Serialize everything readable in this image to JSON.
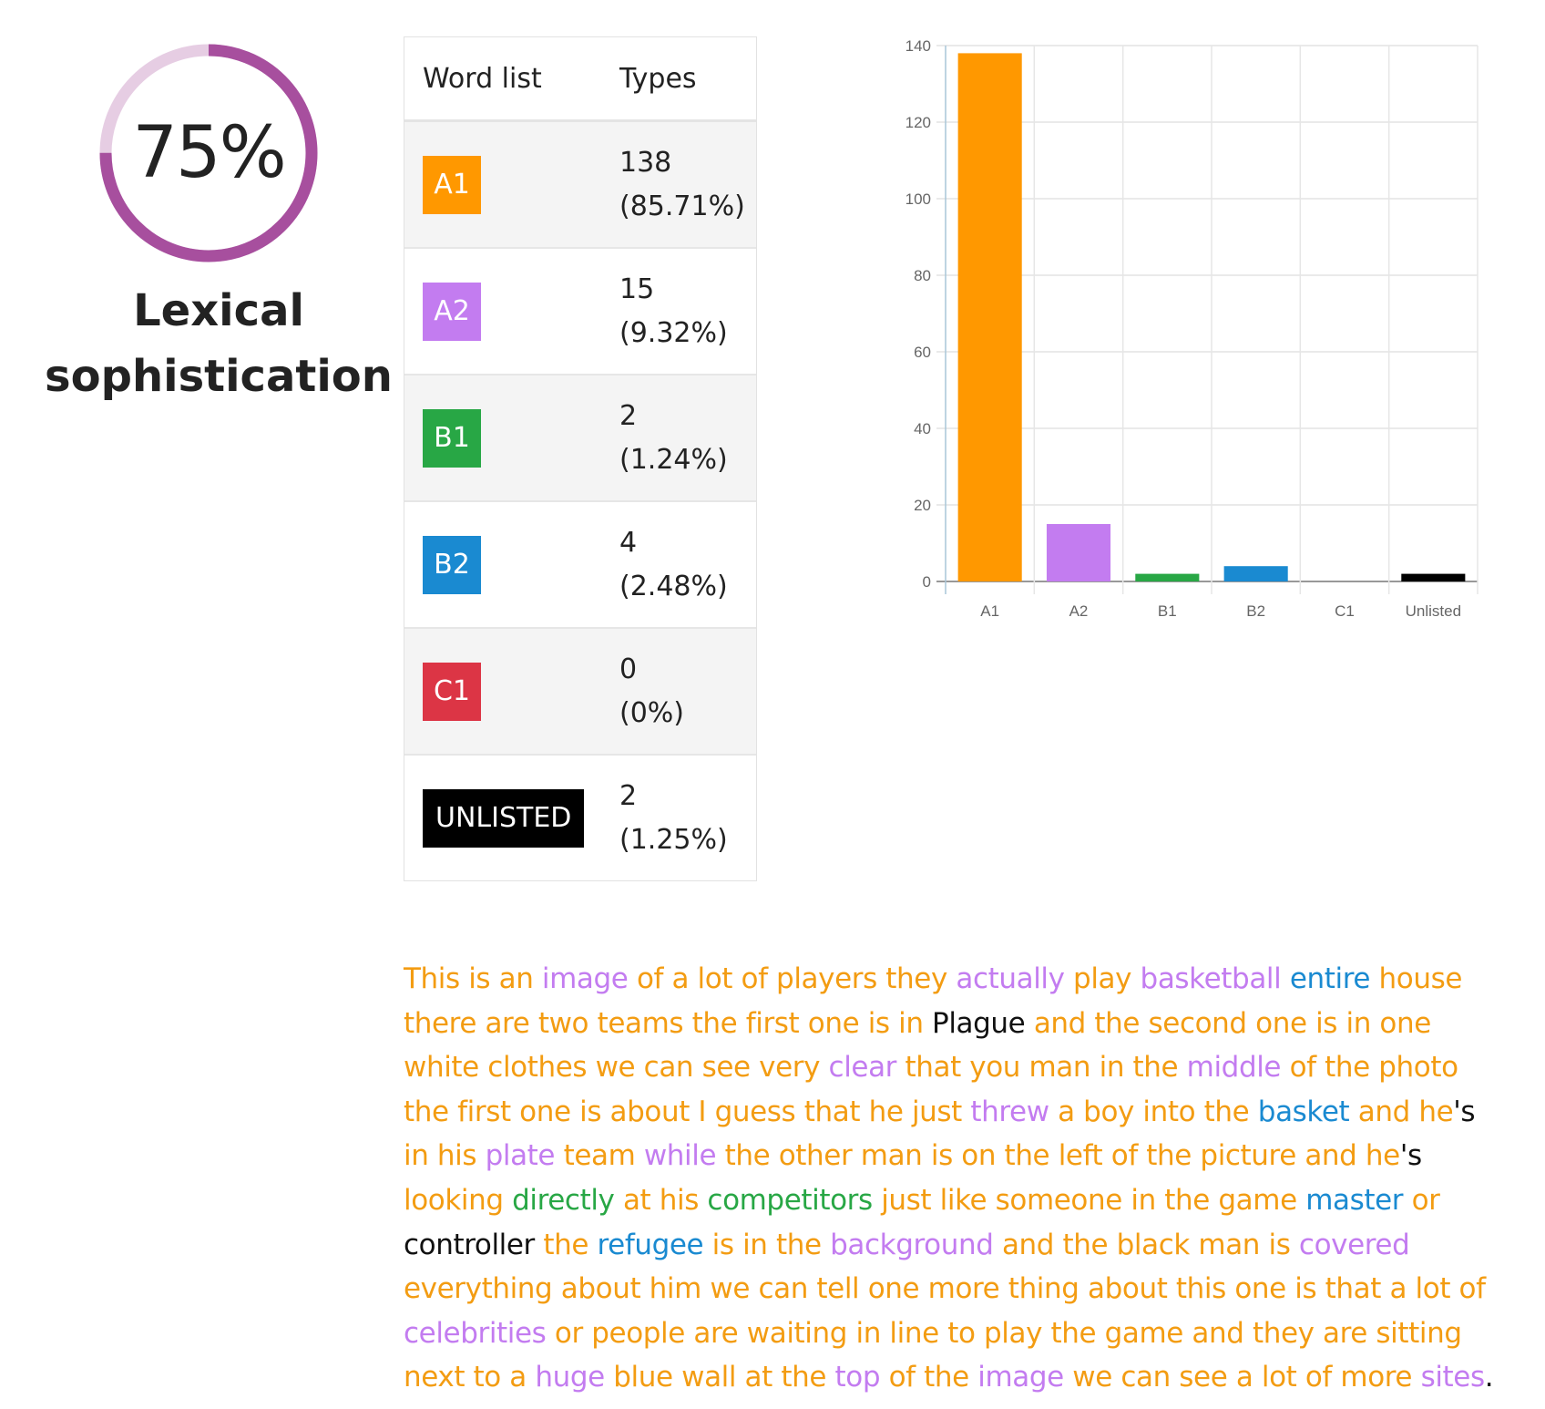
{
  "score": {
    "percent_label": "75%",
    "fraction": 0.75,
    "title_line1": "Lexical",
    "title_line2": "sophistication",
    "ring_color": "#a74f9e",
    "track_color": "#e6cde3"
  },
  "table": {
    "headers": [
      "Word list",
      "Types"
    ],
    "rows": [
      {
        "level": "A1",
        "count": "138",
        "pct": "(85.71%)",
        "color": "#ff9800"
      },
      {
        "level": "A2",
        "count": "15",
        "pct": "(9.32%)",
        "color": "#c37cf0"
      },
      {
        "level": "B1",
        "count": "2",
        "pct": "(1.24%)",
        "color": "#28a745"
      },
      {
        "level": "B2",
        "count": "4",
        "pct": "(2.48%)",
        "color": "#1a8ad1"
      },
      {
        "level": "C1",
        "count": "0",
        "pct": "(0%)",
        "color": "#dc3545"
      },
      {
        "level": "UNLISTED",
        "count": "2",
        "pct": "(1.25%)",
        "color": "#000000"
      }
    ]
  },
  "chart_data": {
    "type": "bar",
    "title": "",
    "xlabel": "",
    "ylabel": "",
    "categories": [
      "A1",
      "A2",
      "B1",
      "B2",
      "C1",
      "Unlisted"
    ],
    "values": [
      138,
      15,
      2,
      4,
      0,
      2
    ],
    "colors": [
      "#ff9800",
      "#c37cf0",
      "#28a745",
      "#1a8ad1",
      "#dc3545",
      "#000000"
    ],
    "ylim": [
      0,
      140
    ],
    "yticks": [
      0,
      20,
      40,
      60,
      80,
      100,
      120,
      140
    ],
    "grid": true,
    "legend": "none"
  },
  "text": {
    "colors": {
      "A1": "#f39c12",
      "A2": "#c37cf0",
      "B1": "#28a745",
      "B2": "#1a8ad1",
      "C1": "#dc3545",
      "U": "#111111"
    },
    "segments": [
      [
        "A1",
        "This is an "
      ],
      [
        "A2",
        "image"
      ],
      [
        "A1",
        " of a lot of players they "
      ],
      [
        "A2",
        "actually"
      ],
      [
        "A1",
        " play "
      ],
      [
        "A2",
        "basketball"
      ],
      [
        "A1",
        " "
      ],
      [
        "B2",
        "entire"
      ],
      [
        "A1",
        " house there are two teams the first one is in "
      ],
      [
        "U",
        "Plague"
      ],
      [
        "A1",
        " and the second one is in one white clothes we can see very "
      ],
      [
        "A2",
        "clear"
      ],
      [
        "A1",
        " that you man in the "
      ],
      [
        "A2",
        "middle"
      ],
      [
        "A1",
        " of the photo the first one is about I guess that he just "
      ],
      [
        "A2",
        "threw"
      ],
      [
        "A1",
        " a boy into the "
      ],
      [
        "B2",
        "basket"
      ],
      [
        "A1",
        " and he"
      ],
      [
        "U",
        "'s"
      ],
      [
        "A1",
        " in his "
      ],
      [
        "A2",
        "plate"
      ],
      [
        "A1",
        " team "
      ],
      [
        "A2",
        "while"
      ],
      [
        "A1",
        " the other man is on the left of the picture and he"
      ],
      [
        "U",
        "'s"
      ],
      [
        "A1",
        " looking "
      ],
      [
        "B1",
        "directly"
      ],
      [
        "A1",
        " at his "
      ],
      [
        "B1",
        "competitors"
      ],
      [
        "A1",
        " just like someone in the game "
      ],
      [
        "B2",
        "master"
      ],
      [
        "A1",
        " or "
      ],
      [
        "U",
        "controller"
      ],
      [
        "A1",
        " the "
      ],
      [
        "B2",
        "refugee"
      ],
      [
        "A1",
        " is in the "
      ],
      [
        "A2",
        "background"
      ],
      [
        "A1",
        " and the black man is "
      ],
      [
        "A2",
        "covered"
      ],
      [
        "A1",
        " everything about him we can tell one more thing about this one is that a lot of "
      ],
      [
        "A2",
        "celebrities"
      ],
      [
        "A1",
        " or people are waiting in line to play the game and they are sitting next to a "
      ],
      [
        "A2",
        "huge"
      ],
      [
        "A1",
        " blue wall at the "
      ],
      [
        "A2",
        "top"
      ],
      [
        "A1",
        " of the "
      ],
      [
        "A2",
        "image"
      ],
      [
        "A1",
        " we can see a lot of more "
      ],
      [
        "A2",
        "sites"
      ],
      [
        "U",
        "."
      ]
    ]
  }
}
